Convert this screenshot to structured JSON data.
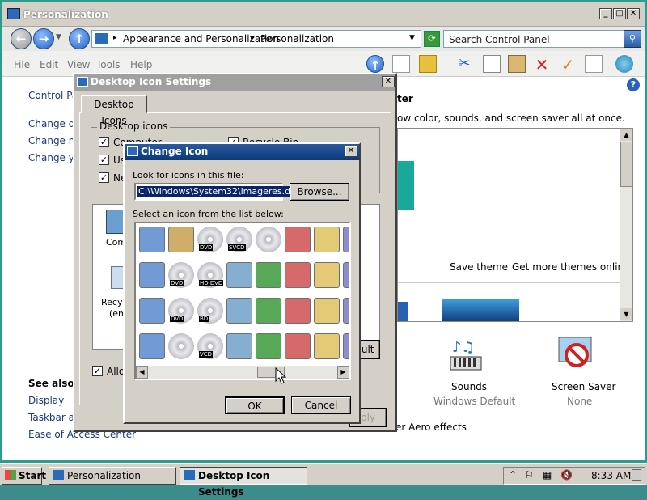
{
  "main_window": {
    "title": "Personalization",
    "breadcrumb": [
      "Appearance and Personalization",
      "Personalization"
    ],
    "search_placeholder": "Search Control Panel",
    "menu": [
      "File",
      "Edit",
      "View",
      "Tools",
      "Help"
    ],
    "sidebar": {
      "top_link": "Control Panel",
      "links": [
        "Change de",
        "Change mo",
        "Change yo"
      ],
      "see_also_heading": "See also",
      "see_also": [
        "Display",
        "Taskbar an",
        "Ease of Access Center"
      ]
    },
    "content": {
      "heading_fragment": "ter",
      "description": "ow color, sounds, and screen saver all at once.",
      "save_theme": "Save theme",
      "more_themes": "Get more themes online",
      "aero_link": "er Aero effects",
      "tiles": [
        {
          "label": "Sounds",
          "sub": "Windows Default",
          "icon": "sounds-icon"
        },
        {
          "label": "Screen Saver",
          "sub": "None",
          "icon": "screen-saver-icon"
        }
      ]
    }
  },
  "desktop_icon_dialog": {
    "title": "Desktop Icon Settings",
    "tab": "Desktop Icons",
    "group_label": "Desktop icons",
    "checkboxes": [
      {
        "label": "Computer",
        "checked": true
      },
      {
        "label": "Us",
        "checked": true
      },
      {
        "label": "Ne",
        "checked": true
      },
      {
        "label": "Recycle Bin",
        "checked": true
      }
    ],
    "icon_labels": [
      "Comp",
      "Recyc",
      "(em"
    ],
    "allow_label": "Allow",
    "default_fragment": "ault",
    "apply_fragment": "ply"
  },
  "change_icon_dialog": {
    "title": "Change Icon",
    "file_label": "Look for icons in this file:",
    "file_value": "C:\\Windows\\System32\\imageres.dll",
    "browse": "Browse...",
    "list_label": "Select an icon from the list below:",
    "ok": "OK",
    "cancel": "Cancel",
    "icons": [
      "briefcase-user-icon",
      "document-icon",
      "film-dvd-icon",
      "svcd-icon",
      "help-disc-icon",
      "monitor-graph-icon",
      "checkmark-icon",
      "device-icon",
      "music-note-icon",
      "dvd-icon",
      "hd-dvd-icon",
      "pushpin-icon",
      "network-icon",
      "monitor-settings-icon",
      "font-t-icon",
      "folder-icon",
      "picture-icon",
      "dvd-film-icon",
      "bd-icon",
      "globe-clock-icon",
      "copy-pages-icon",
      "remote-desktop-icon",
      "font-tc-icon",
      "shortcut-icon",
      "film-strip-icon",
      "music-disc-icon",
      "vcd-icon",
      "search-monitor-icon",
      "laptop-icon",
      "restore-icon",
      "font-o-icon",
      "grid-icon"
    ],
    "dvd_labels": [
      "DVD",
      "SVCD",
      "DVD",
      "HD DVD",
      "DVD",
      "BD",
      "VCD"
    ]
  },
  "taskbar": {
    "start": "Start",
    "buttons": [
      "Personalization",
      "Desktop Icon Settings"
    ],
    "time": "8:33 AM"
  },
  "colors": {
    "titlebar_active": "#0a3878",
    "desktop": "#3c8c8c",
    "link": "#1c3a78"
  }
}
